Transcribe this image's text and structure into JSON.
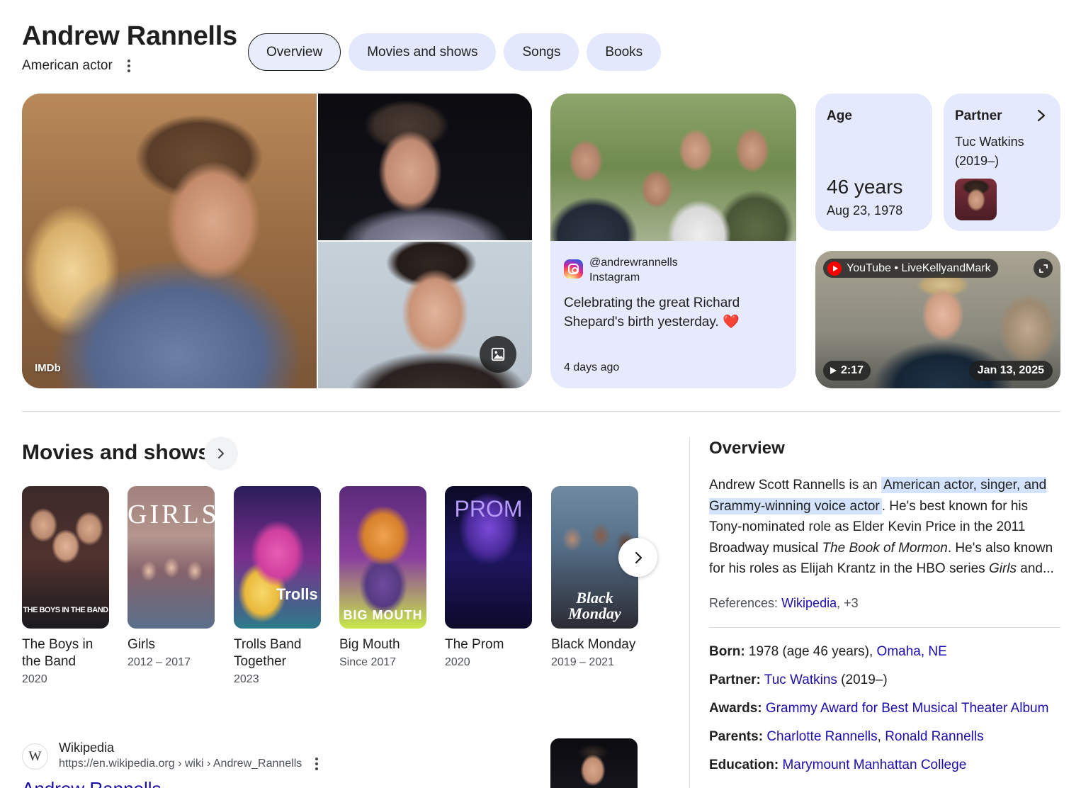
{
  "header": {
    "title": "Andrew Rannells",
    "subtitle": "American actor"
  },
  "tabs": [
    {
      "label": "Overview",
      "active": true
    },
    {
      "label": "Movies and shows",
      "active": false
    },
    {
      "label": "Songs",
      "active": false
    },
    {
      "label": "Books",
      "active": false
    }
  ],
  "gallery": {
    "main_source": "IMDb"
  },
  "instagram": {
    "handle": "@andrewrannells",
    "source": "Instagram",
    "text": "Celebrating the great Richard Shepard's birth yesterday. ❤️",
    "time": "4 days ago"
  },
  "age": {
    "label": "Age",
    "value": "46 years",
    "date": "Aug 23, 1978"
  },
  "partner": {
    "label": "Partner",
    "name": "Tuc Watkins (2019–)"
  },
  "youtube": {
    "channel": "YouTube • LiveKellyandMark",
    "duration": "2:17",
    "date": "Jan 13, 2025"
  },
  "movies": {
    "title": "Movies and shows",
    "items": [
      {
        "title": "The Boys in the Band",
        "year": "2020",
        "poster_text": "THE BOYS IN THE BAND"
      },
      {
        "title": "Girls",
        "year": "2012 – 2017",
        "poster_text": "GIRLS"
      },
      {
        "title": "Trolls Band Together",
        "year": "2023",
        "poster_text": "Trolls"
      },
      {
        "title": "Big Mouth",
        "year": "Since 2017",
        "poster_text": "BIG MOUTH"
      },
      {
        "title": "The Prom",
        "year": "2020",
        "poster_text": "PROM"
      },
      {
        "title": "Black Monday",
        "year": "2019 – 2021",
        "poster_text": "Black Monday"
      }
    ]
  },
  "wikipedia": {
    "name": "Wikipedia",
    "url": "https://en.wikipedia.org › wiki › Andrew_Rannells",
    "link_title": "Andrew Rannells"
  },
  "overview": {
    "title": "Overview",
    "text_before": "Andrew Scott Rannells is an ",
    "text_highlight": "American actor, singer, and Grammy-winning voice actor",
    "text_after_1": ". He's best known for his Tony-nominated role as Elder Kevin Price in the 2011 Broadway musical ",
    "text_italic_1": "The Book of Mormon",
    "text_after_2": ". He's also known for his roles as Elijah Krantz in the HBO series ",
    "text_italic_2": "Girls",
    "text_after_3": " and...",
    "references_label": "References: ",
    "references_link": "Wikipedia",
    "references_more": ", +3"
  },
  "facts": {
    "born_label": "Born:",
    "born_text": " 1978 (age 46 years), ",
    "born_link": "Omaha, NE",
    "partner_label": "Partner:",
    "partner_link": "Tuc Watkins",
    "partner_text": " (2019–)",
    "awards_label": "Awards:",
    "awards_link": "Grammy Award for Best Musical Theater Album",
    "parents_label": "Parents:",
    "parents_link_1": "Charlotte Rannells",
    "parents_sep": ", ",
    "parents_link_2": "Ronald Rannells",
    "education_label": "Education:",
    "education_link": "Marymount Manhattan College"
  }
}
